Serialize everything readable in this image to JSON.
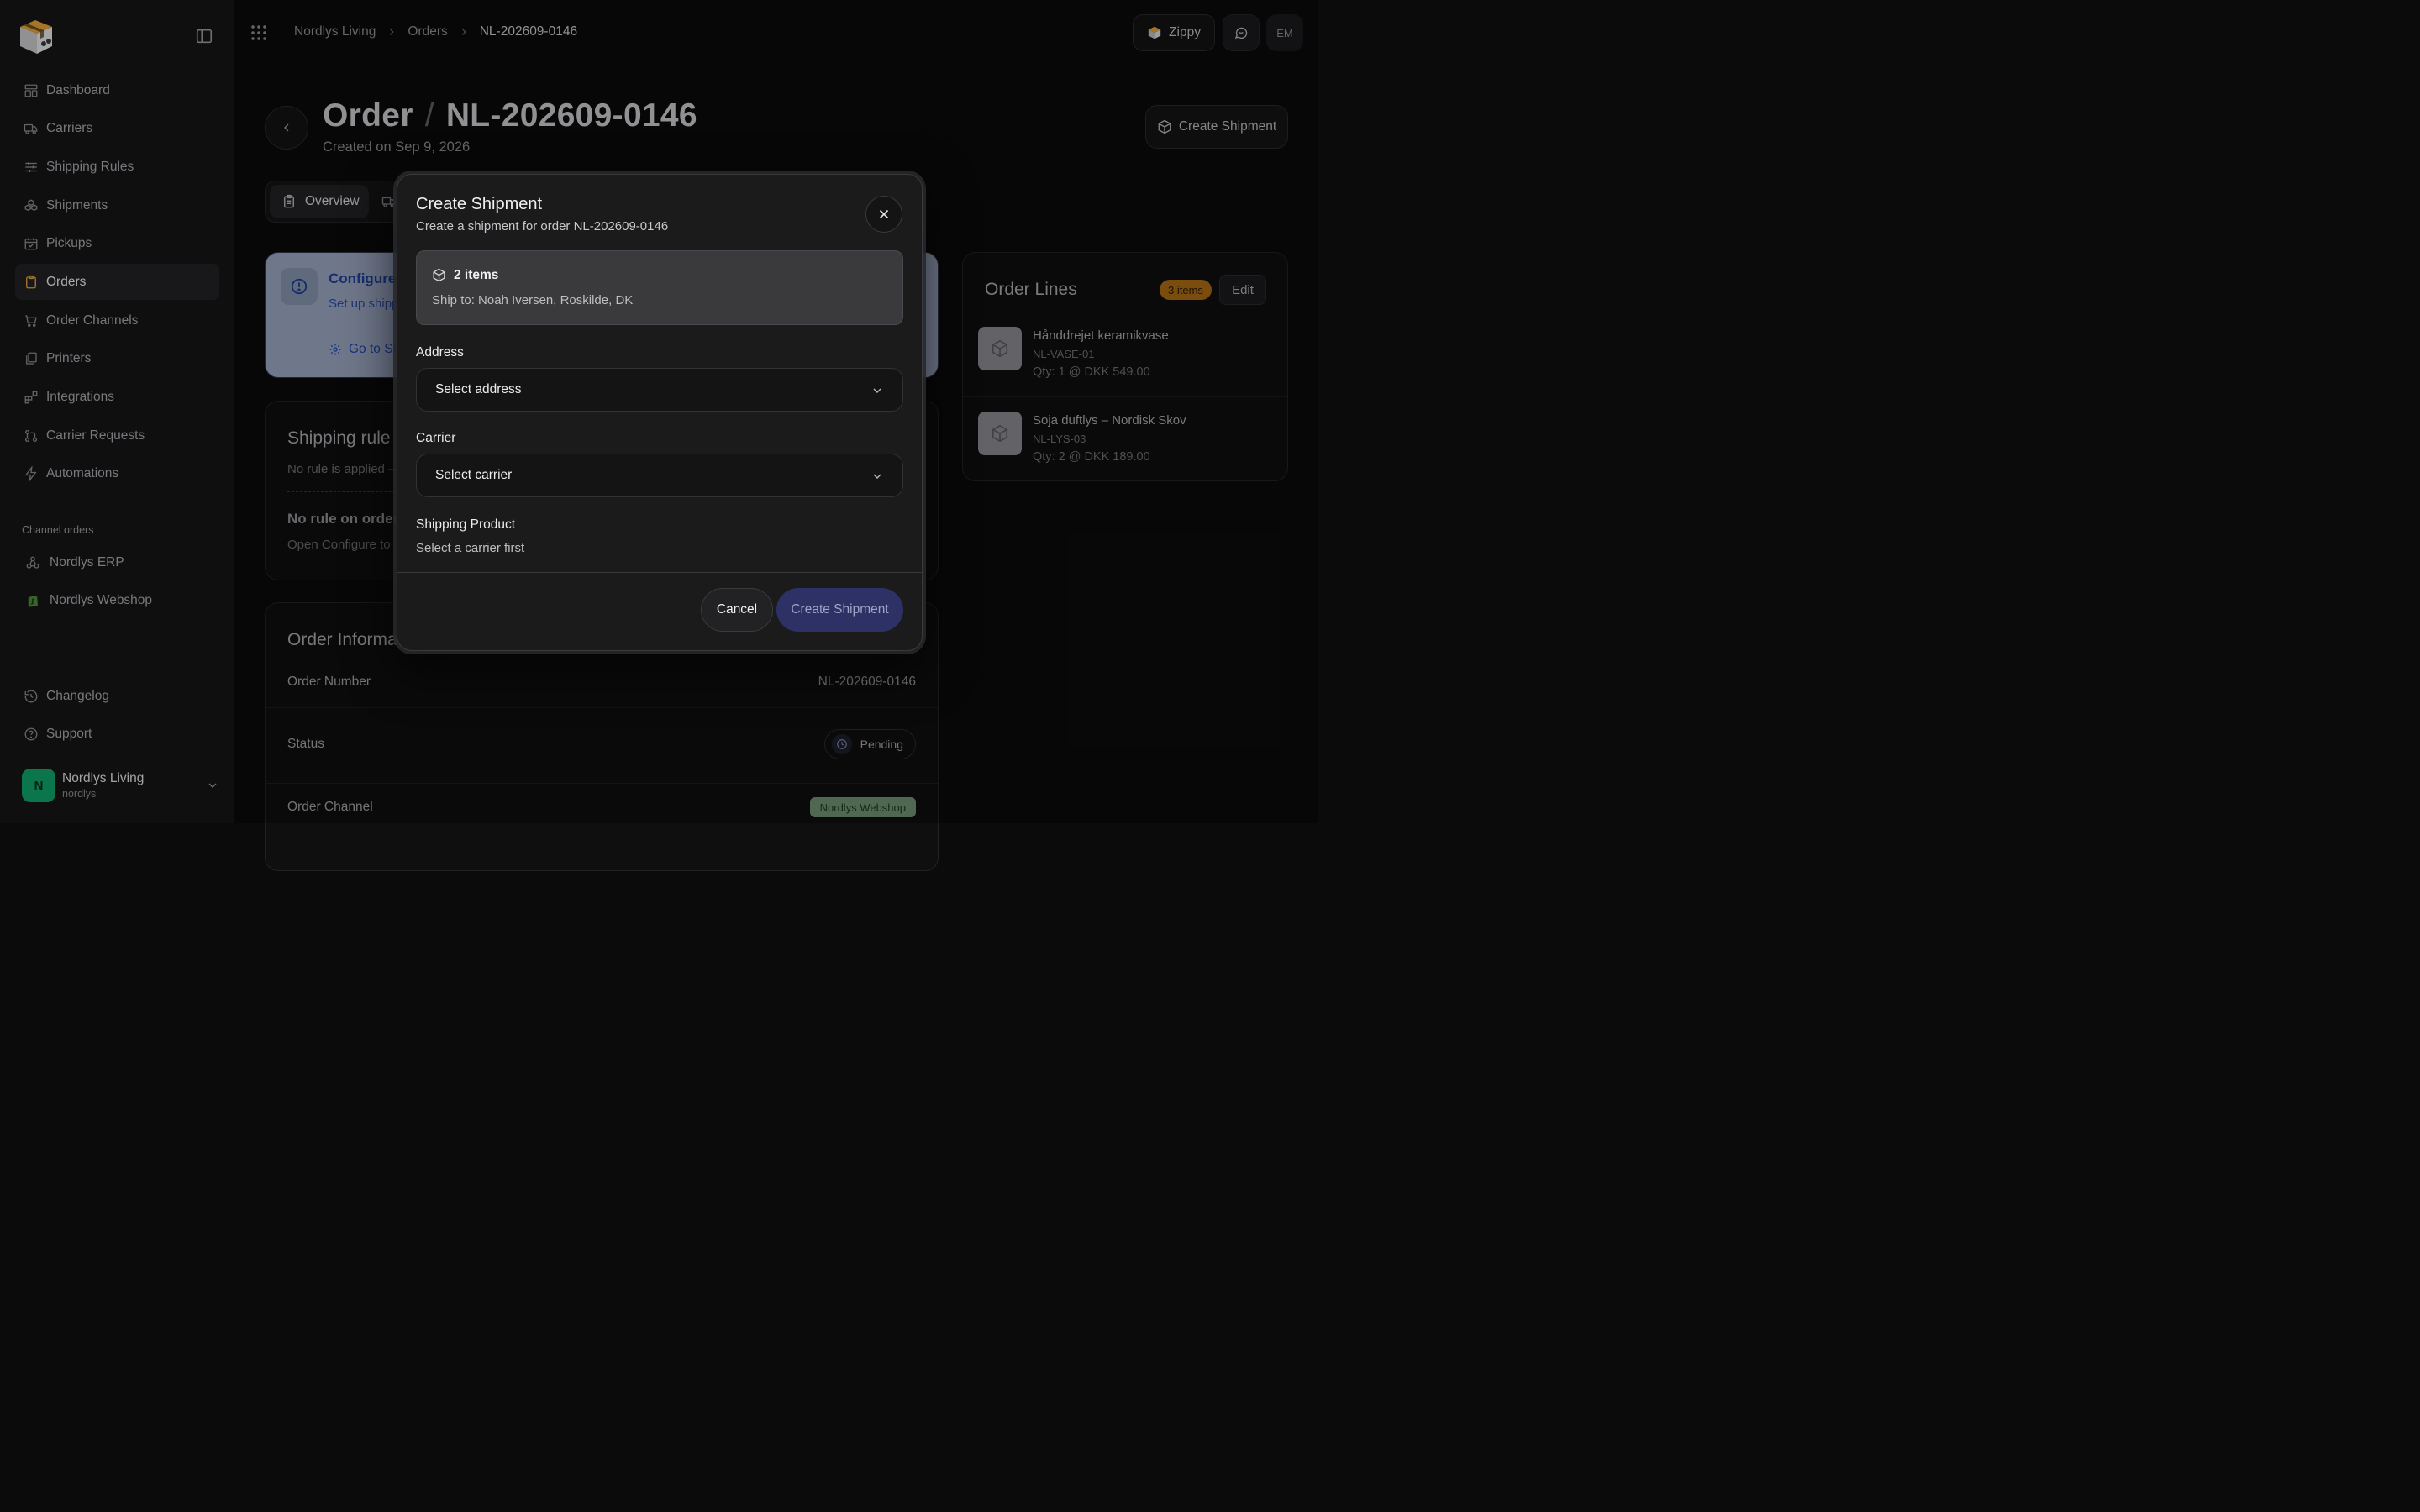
{
  "sidebar": {
    "nav": [
      {
        "label": "Dashboard",
        "icon": "dashboard-icon"
      },
      {
        "label": "Carriers",
        "icon": "truck-icon"
      },
      {
        "label": "Shipping Rules",
        "icon": "sliders-icon"
      },
      {
        "label": "Shipments",
        "icon": "boxes-icon"
      },
      {
        "label": "Pickups",
        "icon": "calendar-check-icon"
      },
      {
        "label": "Orders",
        "icon": "clipboard-icon",
        "active": true
      },
      {
        "label": "Order Channels",
        "icon": "cart-icon"
      },
      {
        "label": "Printers",
        "icon": "printer-icon"
      },
      {
        "label": "Integrations",
        "icon": "blocks-icon"
      },
      {
        "label": "Carrier Requests",
        "icon": "git-pull-icon"
      },
      {
        "label": "Automations",
        "icon": "bolt-icon"
      }
    ],
    "channel_section_label": "Channel orders",
    "channels": [
      {
        "label": "Nordlys ERP",
        "icon": "webhook-icon"
      },
      {
        "label": "Nordlys Webshop",
        "icon": "shopify-icon"
      }
    ],
    "bottom": [
      {
        "label": "Changelog",
        "icon": "history-icon"
      },
      {
        "label": "Support",
        "icon": "help-circle-icon"
      }
    ],
    "user": {
      "initial": "N",
      "name": "Nordlys Living",
      "handle": "nordlys"
    }
  },
  "topbar": {
    "breadcrumbs": [
      "Nordlys Living",
      "Orders",
      "NL-202609-0146"
    ],
    "zippy_label": "Zippy",
    "user_initials": "EM"
  },
  "page": {
    "title_prefix": "Order",
    "title_slash": "/",
    "order_number": "NL-202609-0146",
    "created": "Created on Sep 9, 2026",
    "create_shipment_label": "Create Shipment",
    "tab_overview": "Overview"
  },
  "config_card": {
    "title": "Configure",
    "text": "Set up shipp destination.",
    "link": "Go to Sh"
  },
  "rules_card": {
    "title": "Shipping rule",
    "subtitle": "No rule is applied —",
    "heading": "No rule on order",
    "text": "Open Configure to"
  },
  "info_card": {
    "title": "Order Informa",
    "rows": [
      {
        "label": "Order Number",
        "value": "NL-202609-0146"
      },
      {
        "label": "Status",
        "value": "Pending"
      },
      {
        "label": "Order Channel",
        "value": "Nordlys Webshop"
      }
    ]
  },
  "lines_card": {
    "title": "Order Lines",
    "badge": "3 items",
    "edit_label": "Edit",
    "items": [
      {
        "name": "Hånddrejet keramikvase",
        "sku": "NL-VASE-01",
        "qty": "Qty: 1  @ DKK 549.00"
      },
      {
        "name": "Soja duftlys – Nordisk Skov",
        "sku": "NL-LYS-03",
        "qty": "Qty: 2  @ DKK 189.00"
      }
    ]
  },
  "modal": {
    "title": "Create Shipment",
    "subtitle": "Create a shipment for order NL-202609-0146",
    "items_count": "2 items",
    "ship_to": "Ship to: Noah Iversen, Roskilde, DK",
    "address_label": "Address",
    "address_placeholder": "Select address",
    "carrier_label": "Carrier",
    "carrier_placeholder": "Select carrier",
    "product_label": "Shipping Product",
    "product_hint": "Select a carrier first",
    "cancel_label": "Cancel",
    "create_label": "Create Shipment"
  },
  "colors": {
    "accent": "#e8a33a",
    "primary_button": "#2e3166",
    "avatar": "#10a36a",
    "badge_orange": "#a96b14"
  }
}
